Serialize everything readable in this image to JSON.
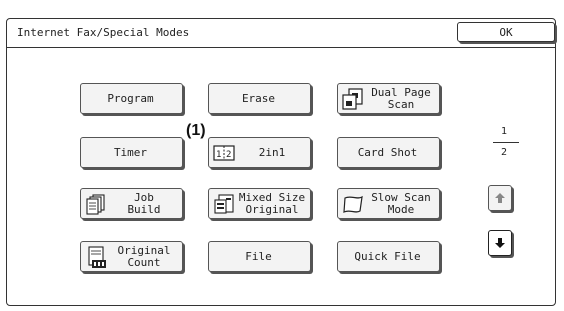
{
  "window": {
    "title": "Internet Fax/Special Modes",
    "ok_label": "OK"
  },
  "buttons": {
    "program": "Program",
    "erase": "Erase",
    "dual_page_scan": "Dual Page\nScan",
    "timer": "Timer",
    "two_in_one": "2in1",
    "card_shot": "Card Shot",
    "job_build": "Job\nBuild",
    "mixed_size_original": "Mixed Size\nOriginal",
    "slow_scan_mode": "Slow Scan\nMode",
    "original_count": "Original\nCount",
    "file": "File",
    "quick_file": "Quick File"
  },
  "callout": "(1)",
  "two_in_one_icon_text": "1|2",
  "pagination": {
    "current": "1",
    "total": "2"
  },
  "icons": {
    "dual_page_scan": "dual-page-scan-icon",
    "two_in_one": "two-in-one-icon",
    "job_build": "job-build-icon",
    "mixed_size_original": "mixed-size-original-icon",
    "slow_scan_mode": "slow-scan-icon",
    "original_count": "original-count-icon",
    "page_up": "up-arrow-icon",
    "page_down": "down-arrow-icon"
  }
}
